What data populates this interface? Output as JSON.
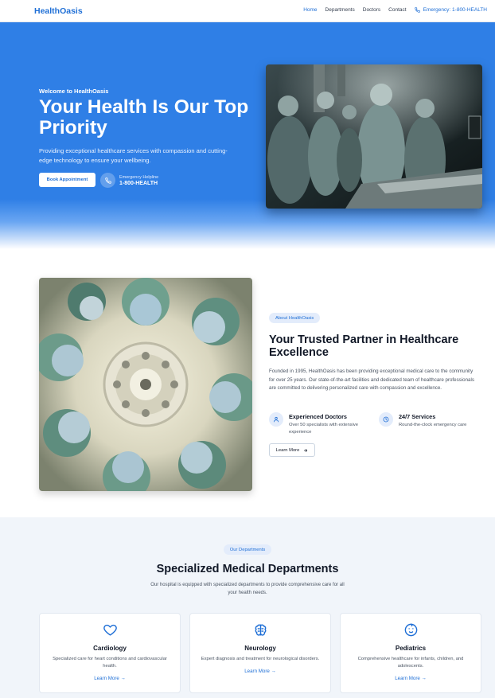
{
  "colors": {
    "primary": "#1f6fd6",
    "hero_bg": "#2f7fe6",
    "section_bg": "#f1f5fa"
  },
  "nav": {
    "brand": "HealthOasis",
    "links": [
      "Home",
      "Departments",
      "Doctors",
      "Contact"
    ],
    "emergency": "Emergency: 1-800-HEALTH",
    "emergency_icon": "phone-icon"
  },
  "hero": {
    "eyebrow": "Welcome to HealthOasis",
    "title": "Your Health Is Our Top Priority",
    "subtitle": "Providing exceptional healthcare services with compassion and cutting-edge technology to ensure your wellbeing.",
    "cta": "Book Appointment",
    "helpline_label": "Emergency Helpline",
    "helpline_number": "1-800-HEALTH",
    "image": "surgeons-operating-photo"
  },
  "about": {
    "pill": "About HealthOasis",
    "title": "Your Trusted Partner in Healthcare Excellence",
    "body": "Founded in 1995, HealthOasis has been providing exceptional medical care to the community for over 25 years. Our state-of-the-art facilities and dedicated team of healthcare professionals are committed to delivering personalized care with compassion and excellence.",
    "image": "surgeons-circle-looking-down-photo",
    "features": [
      {
        "title": "Experienced Doctors",
        "desc": "Over 50 specialists with extensive experience",
        "icon": "user-icon"
      },
      {
        "title": "24/7 Services",
        "desc": "Round-the-clock emergency care",
        "icon": "clock-icon"
      }
    ],
    "cta": "Learn More"
  },
  "departments": {
    "pill": "Our Departments",
    "title": "Specialized Medical Departments",
    "subtitle": "Our hospital is equipped with specialized departments to provide comprehensive care for all your health needs.",
    "cards": [
      {
        "title": "Cardiology",
        "desc": "Specialized care for heart conditions and cardiovascular health.",
        "link": "Learn More →",
        "icon": "heart-icon"
      },
      {
        "title": "Neurology",
        "desc": "Expert diagnosis and treatment for neurological disorders.",
        "link": "Learn More →",
        "icon": "brain-icon"
      },
      {
        "title": "Pediatrics",
        "desc": "Comprehensive healthcare for infants, children, and adolescents.",
        "link": "Learn More →",
        "icon": "baby-icon"
      }
    ]
  }
}
